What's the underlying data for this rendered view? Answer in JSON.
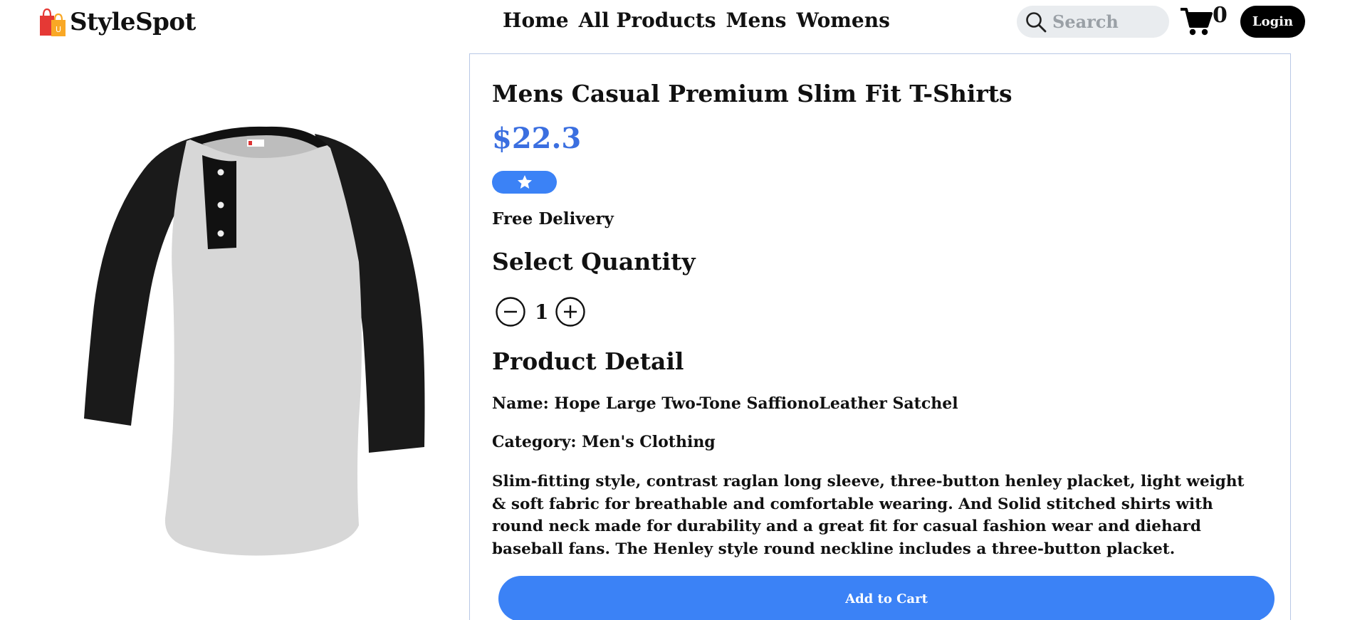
{
  "brand": {
    "name": "StyleSpot",
    "logo_icon": "shopping-bags-logo"
  },
  "nav": {
    "items": [
      "Home",
      "All Products",
      "Mens",
      "Womens"
    ]
  },
  "search": {
    "placeholder": "Search",
    "value": "",
    "icon": "search-icon"
  },
  "cart": {
    "count": "0",
    "icon": "cart-icon"
  },
  "login": {
    "label": "Login"
  },
  "product": {
    "title": "Mens Casual Premium Slim Fit T-Shirts",
    "price": "$22.3",
    "rating_icon": "star-icon",
    "delivery": "Free Delivery",
    "quantity_title": "Select Quantity",
    "quantity": "1",
    "detail_title": "Product Detail",
    "name_line": "Name: Hope Large Two-Tone SaffionoLeather Satchel",
    "category_line": "Category: Men's Clothing",
    "description": "Slim-fitting style, contrast raglan long sleeve, three-button henley placket, light weight & soft fabric for breathable and comfortable wearing. And Solid stitched shirts with round neck made for durability and a great fit for casual fashion wear and diehard baseball fans. The Henley style round neckline includes a three-button placket.",
    "add_to_cart": "Add to Cart",
    "image_icon": "raglan-henley-shirt-image"
  },
  "colors": {
    "accent": "#3b82f6",
    "price": "#3b6fe0",
    "panel_border": "#b8c8e6",
    "search_bg": "#e9ecef",
    "login_bg": "#000000"
  }
}
